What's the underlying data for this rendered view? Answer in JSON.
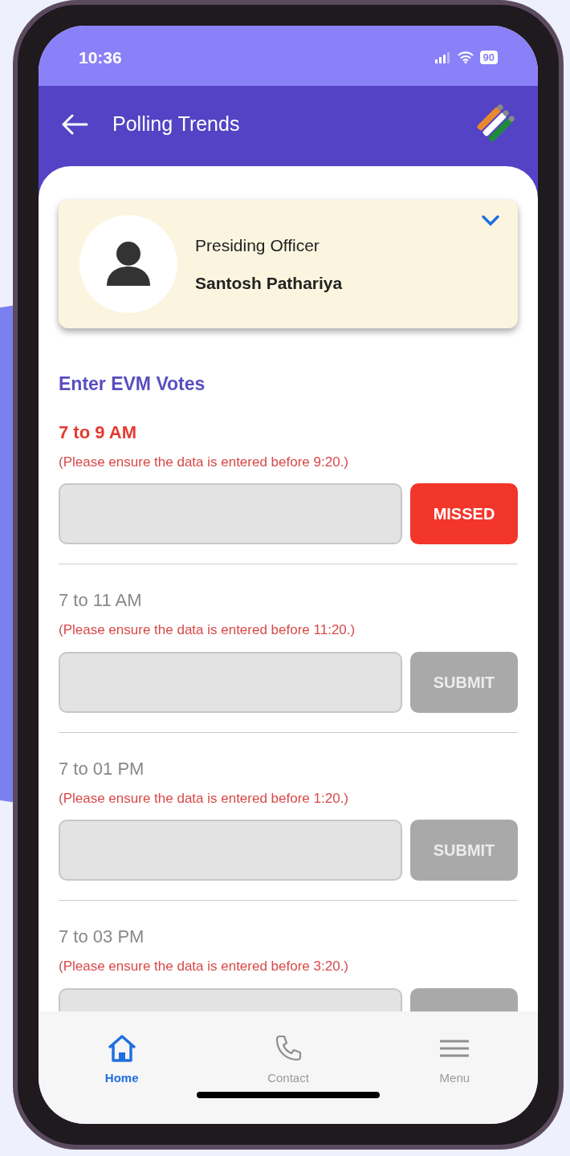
{
  "status_bar": {
    "time": "10:36",
    "battery": "90"
  },
  "header": {
    "title": "Polling Trends"
  },
  "officer_card": {
    "role": "Presiding Officer",
    "name": "Santosh Pathariya",
    "expanded": false
  },
  "section_title": "Enter EVM Votes",
  "slots": [
    {
      "kind": "missed",
      "title": "7 to 9 AM",
      "hint": "(Please ensure the data is entered before 9:20.)",
      "button": "MISSED"
    },
    {
      "kind": "upcoming",
      "title": "7 to 11 AM",
      "hint": "(Please ensure the data is entered before 11:20.)",
      "button": "SUBMIT"
    },
    {
      "kind": "upcoming",
      "title": "7 to 01 PM",
      "hint": "(Please ensure the data is entered before 1:20.)",
      "button": "SUBMIT"
    },
    {
      "kind": "upcoming",
      "title": "7 to 03 PM",
      "hint": "(Please ensure the data is entered before 3:20.)"
    }
  ],
  "nav": [
    {
      "kind": "home",
      "label": "Home",
      "selected": true
    },
    {
      "kind": "contact",
      "label": "Contact",
      "selected": false
    },
    {
      "kind": "menu",
      "label": "Menu",
      "selected": false
    }
  ]
}
